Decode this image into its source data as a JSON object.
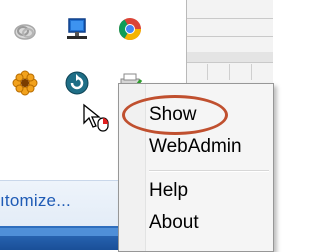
{
  "tray": {
    "customize_label": "ıtomize...",
    "icons": [
      "cloud-icon",
      "network-monitor-icon",
      "chrome-icon",
      "flower-app-icon",
      "refresh-sync-icon",
      "printer-check-icon"
    ]
  },
  "context_menu": {
    "items": [
      {
        "label": "Show",
        "highlighted": true
      },
      {
        "label": "WebAdmin"
      },
      {
        "label": "Help"
      },
      {
        "label": "About"
      }
    ]
  },
  "colors": {
    "annotation_ring": "#c0502f",
    "link": "#1f5bb5",
    "taskbar": "#1a4f98"
  }
}
